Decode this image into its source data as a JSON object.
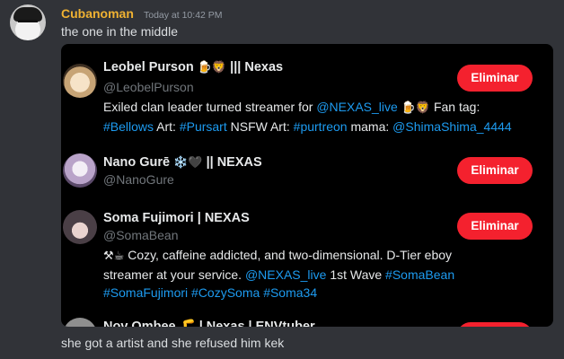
{
  "message_1": {
    "username": "Cubanoman",
    "timestamp": "Today at 10:42 PM",
    "text": "the one in the middle"
  },
  "accounts": [
    {
      "name_prefix": "Leobel Purson",
      "name_emoji": "🍺🦁",
      "name_suffix": "||| Nexas",
      "handle": "@LeobelPurson",
      "remove_label": "Eliminar",
      "bio": {
        "l1_text": "Exiled clan leader turned streamer for ",
        "l1_link": "@NEXAS_live",
        "l1_emoji": "🍺🦁",
        "l1_tail": "Fan tag:",
        "l2_tag1": "#Bellows",
        "l2_art": "Art:",
        "l2_tag2": "#Pursart",
        "l2_nsfw": "NSFW Art:",
        "l2_tag3": "#purtreon",
        "l2_mama": "mama:",
        "l2_link": "@ShimaShima_4444"
      }
    },
    {
      "name_prefix": "Nano Gurē",
      "name_emoji": "❄️🖤",
      "name_suffix": "|| NEXAS",
      "handle": "@NanoGure",
      "remove_label": "Eliminar"
    },
    {
      "name": "Soma Fujimori | NEXAS",
      "handle": "@SomaBean",
      "remove_label": "Eliminar",
      "bio": {
        "l1_emoji": "⚒☕",
        "l1_text": "Cozy, caffeine addicted, and two-dimensional. D-Tier eboy",
        "l2_text": "streamer at your service.",
        "l2_link": "@NEXAS_live",
        "l2_mid": "1st Wave",
        "l2_tag": "#SomaBean",
        "l3_tag1": "#SomaFujimori",
        "l3_tag2": "#CozySoma",
        "l3_tag3": "#Soma34"
      }
    },
    {
      "name": "Nov Ombee 🦵 | Nexas | ENVtuber"
    }
  ],
  "message_2": {
    "text": "she got a artist and she refused him kek"
  },
  "colors": {
    "background": "#313338",
    "username": "#f0b232",
    "embed_bg": "#000000",
    "link": "#1d9bf0",
    "button": "#f4212e"
  }
}
